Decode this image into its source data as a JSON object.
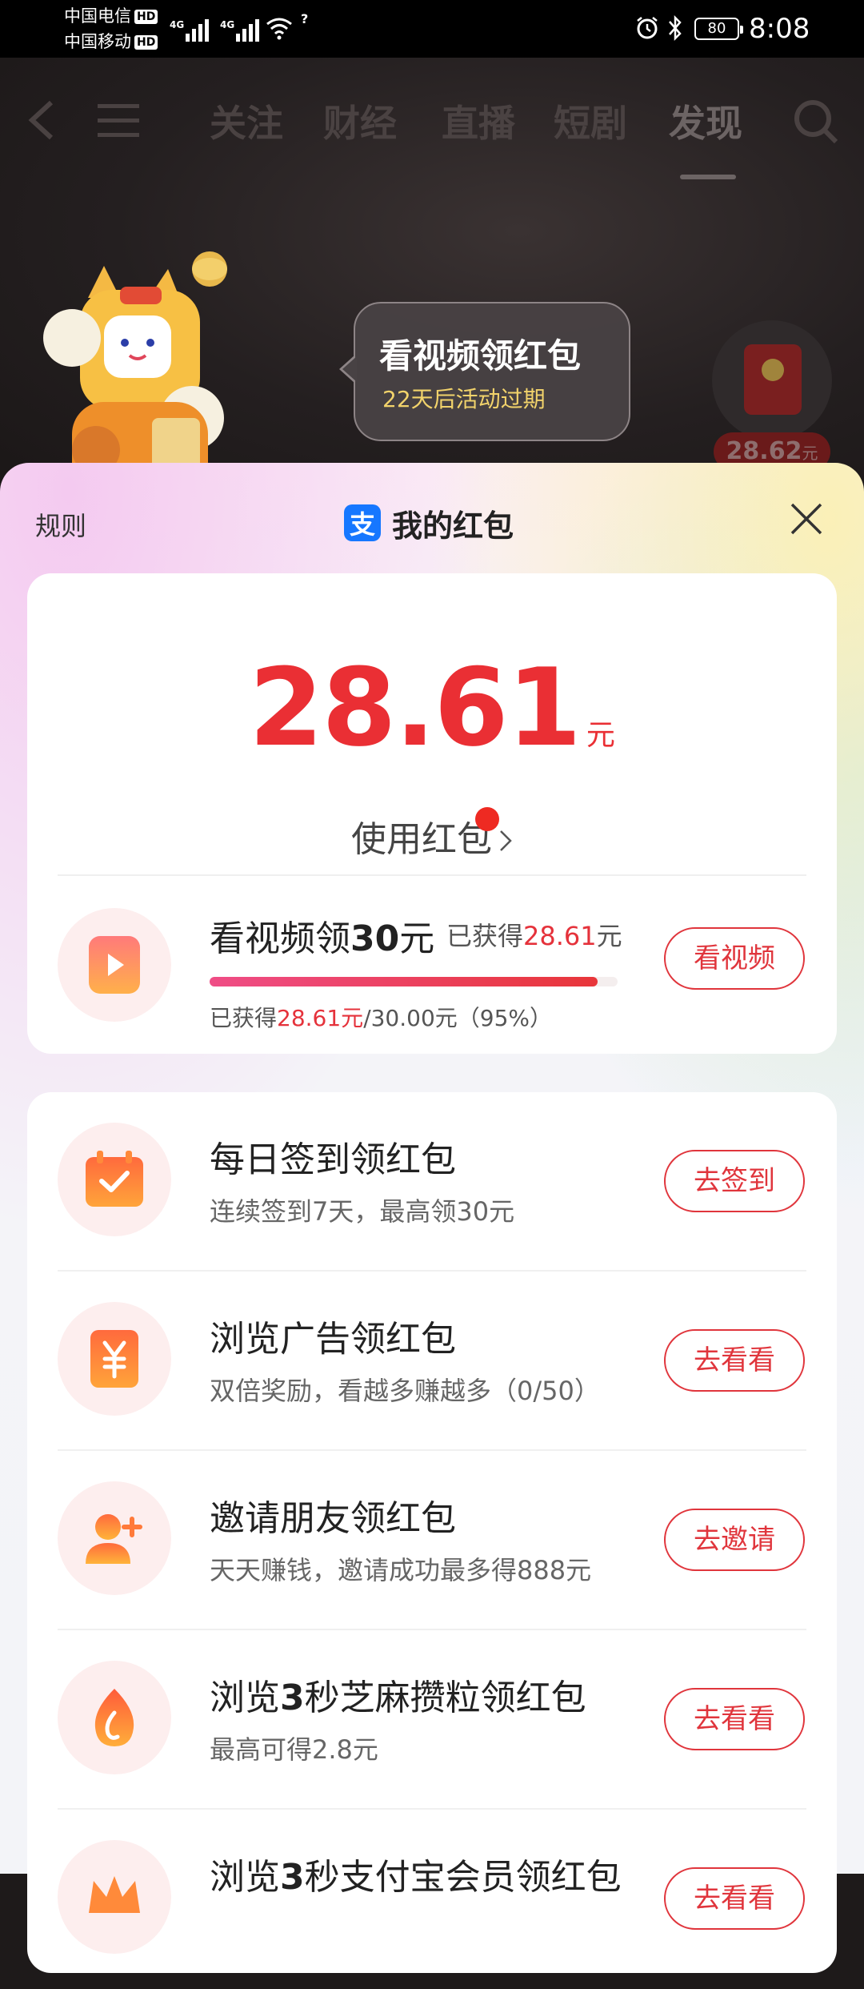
{
  "status_bar": {
    "carrier_1": "中国电信",
    "carrier_2": "中国移动",
    "hd_badge": "HD",
    "network_1": "4G",
    "network_2": "4G",
    "wifi_badge": "?",
    "battery": "80",
    "time": "8:08"
  },
  "nav": {
    "tabs": [
      "关注",
      "财经",
      "直播",
      "短剧",
      "发现"
    ],
    "active_tab": "发现"
  },
  "promo": {
    "bubble_title": "看视频领红包",
    "bubble_subtitle": "22天后活动过期",
    "corner_amount": "28.62",
    "corner_unit": "元"
  },
  "sheet": {
    "rules_label": "规则",
    "title": "我的红包",
    "logo_glyph": "支",
    "balance": {
      "amount": "28.61",
      "unit": "元",
      "use_label": "使用红包"
    },
    "video_task": {
      "title_prefix": "看视频领",
      "title_amount": "30",
      "title_suffix": "元",
      "earned_prefix": "已获得",
      "earned_amount": "28.61",
      "earned_suffix": "元",
      "progress_prefix": "已获得",
      "progress_earned": "28.61元",
      "progress_rest": "/30.00元（95%）",
      "progress": 0.95,
      "button_label": "看视频"
    },
    "tasks": [
      {
        "title_a": "每日签到领红包",
        "title_b": "",
        "title_c": "",
        "desc": "连续签到7天，最高领30元",
        "button": "去签到",
        "icon": "calendar-check-icon"
      },
      {
        "title_a": "浏览广告领红包",
        "title_b": "",
        "title_c": "",
        "desc": "双倍奖励，看越多赚越多（0/50）",
        "button": "去看看",
        "icon": "yuan-coupon-icon"
      },
      {
        "title_a": "邀请朋友领红包",
        "title_b": "",
        "title_c": "",
        "desc": "天天赚钱，邀请成功最多得888元",
        "button": "去邀请",
        "icon": "add-friend-icon"
      },
      {
        "title_a": "浏览",
        "title_b": "3",
        "title_c": "秒芝麻攒粒领红包",
        "desc": "最高可得2.8元",
        "button": "去看看",
        "icon": "sesame-flame-icon"
      },
      {
        "title_a": "浏览",
        "title_b": "3",
        "title_c": "秒支付宝会员领红包",
        "desc": "",
        "button": "去看看",
        "icon": "member-crown-icon"
      }
    ]
  },
  "colors": {
    "accent_red": "#e5323b",
    "alipay_blue": "#1677ff",
    "bubble_text_gold": "#f2d36b"
  }
}
